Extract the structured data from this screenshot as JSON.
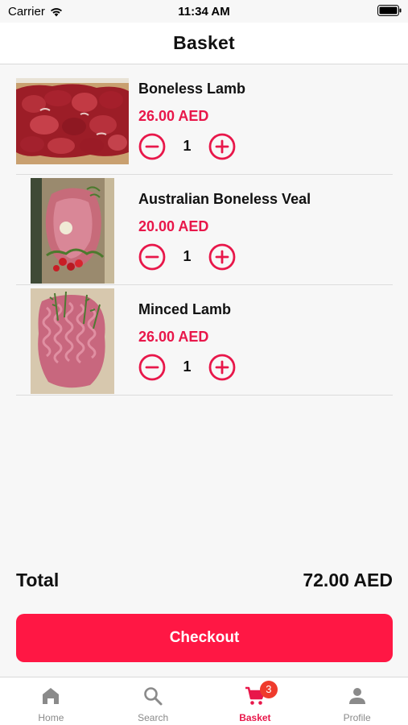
{
  "status_bar": {
    "carrier": "Carrier",
    "time": "11:34 AM"
  },
  "header": {
    "title": "Basket"
  },
  "basket": {
    "items": [
      {
        "name": "Boneless Lamb",
        "price": "26.00 AED",
        "quantity": "1",
        "image": "boneless-lamb-image"
      },
      {
        "name": "Australian Boneless Veal",
        "price": "20.00 AED",
        "quantity": "1",
        "image": "australian-boneless-veal-image"
      },
      {
        "name": "Minced Lamb",
        "price": "26.00 AED",
        "quantity": "1",
        "image": "minced-lamb-image"
      }
    ],
    "total_label": "Total",
    "total_value": "72.00 AED",
    "checkout_label": "Checkout"
  },
  "tabs": [
    {
      "label": "Home",
      "icon": "home-icon",
      "active": false
    },
    {
      "label": "Search",
      "icon": "search-icon",
      "active": false
    },
    {
      "label": "Basket",
      "icon": "cart-icon",
      "active": true,
      "badge": "3"
    },
    {
      "label": "Profile",
      "icon": "person-icon",
      "active": false
    }
  ],
  "colors": {
    "accent": "#ff1744",
    "price": "#e8174a",
    "badge": "#ef3b2c",
    "inactive": "#8a8a8a"
  }
}
